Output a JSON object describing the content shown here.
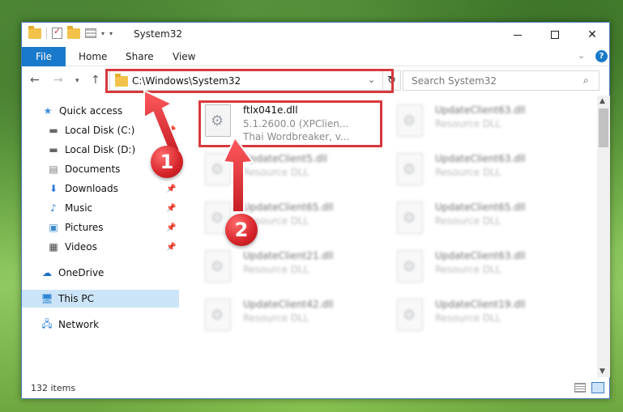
{
  "window": {
    "title": "System32"
  },
  "ribbon": {
    "file_tab": "File",
    "home_tab": "Home",
    "share_tab": "Share",
    "view_tab": "View"
  },
  "address": {
    "path": "C:\\Windows\\System32",
    "search_placeholder": "Search System32"
  },
  "navpane": {
    "items": [
      {
        "label": "Quick access",
        "icon": "star-icon"
      },
      {
        "label": "Local Disk (C:)",
        "icon": "drive-icon",
        "pinned": true
      },
      {
        "label": "Local Disk (D:)",
        "icon": "drive-icon",
        "pinned": true
      },
      {
        "label": "Documents",
        "icon": "documents-icon",
        "pinned": true
      },
      {
        "label": "Downloads",
        "icon": "download-icon",
        "pinned": true
      },
      {
        "label": "Music",
        "icon": "music-icon",
        "pinned": true
      },
      {
        "label": "Pictures",
        "icon": "pictures-icon",
        "pinned": true
      },
      {
        "label": "Videos",
        "icon": "videos-icon",
        "pinned": true
      },
      {
        "label": "OneDrive",
        "icon": "cloud-icon"
      },
      {
        "label": "This PC",
        "icon": "computer-icon",
        "selected": true
      },
      {
        "label": "Network",
        "icon": "network-icon"
      }
    ]
  },
  "files": {
    "main": {
      "name": "ftlx041e.dll",
      "version": "5.1.2600.0 (XPClien...",
      "description": "Thai Wordbreaker, v..."
    },
    "blurred": [
      {
        "name": "UpdateClient63.dll",
        "type": "Resource DLL"
      },
      {
        "name": "UpdateClient5.dll",
        "type": "Resource DLL"
      },
      {
        "name": "UpdateClient63.dll",
        "type": "Resource DLL"
      },
      {
        "name": "UpdateClient65.dll",
        "type": "Resource DLL"
      },
      {
        "name": "UpdateClient65.dll",
        "type": "Resource DLL"
      },
      {
        "name": "UpdateClient21.dll",
        "type": "Resource DLL"
      },
      {
        "name": "UpdateClient63.dll",
        "type": "Resource DLL"
      },
      {
        "name": "UpdateClient42.dll",
        "type": "Resource DLL"
      },
      {
        "name": "UpdateClient19.dll",
        "type": "Resource DLL"
      }
    ]
  },
  "status": {
    "item_count": "132 items"
  },
  "callouts": {
    "step1": "1",
    "step2": "2"
  },
  "colors": {
    "accent": "#1979ca",
    "callout": "#d7393c",
    "selected": "#cce4f7"
  }
}
